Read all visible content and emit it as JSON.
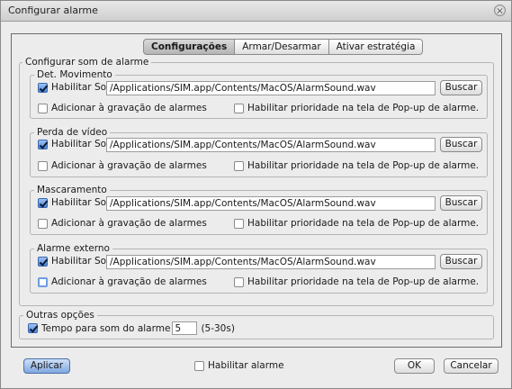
{
  "window": {
    "title": "Configurar alarme",
    "close_glyph": "×"
  },
  "tabs": [
    {
      "label": "Configurações",
      "active": true
    },
    {
      "label": "Armar/Desarmar",
      "active": false
    },
    {
      "label": "Ativar estratégia",
      "active": false
    }
  ],
  "sound_section": {
    "legend": "Configurar som de alarme",
    "groups": [
      {
        "legend": "Det. Movimento",
        "enable_label": "Habilitar Som",
        "enable_checked": true,
        "path": "/Applications/SIM.app/Contents/MacOS/AlarmSound.wav",
        "browse_label": "Buscar",
        "record_label": "Adicionar à gravação de alarmes",
        "record_checked": false,
        "priority_label": "Habilitar prioridade na tela de Pop-up de alarme.",
        "priority_checked": false
      },
      {
        "legend": "Perda de vídeo",
        "enable_label": "Habilitar Som",
        "enable_checked": true,
        "path": "/Applications/SIM.app/Contents/MacOS/AlarmSound.wav",
        "browse_label": "Buscar",
        "record_label": "Adicionar à gravação de alarmes",
        "record_checked": false,
        "priority_label": "Habilitar prioridade na tela de Pop-up de alarme.",
        "priority_checked": false
      },
      {
        "legend": "Mascaramento",
        "enable_label": "Habilitar Som",
        "enable_checked": true,
        "path": "/Applications/SIM.app/Contents/MacOS/AlarmSound.wav",
        "browse_label": "Buscar",
        "record_label": "Adicionar à gravação de alarmes",
        "record_checked": false,
        "priority_label": "Habilitar prioridade na tela de Pop-up de alarme.",
        "priority_checked": false
      },
      {
        "legend": "Alarme externo",
        "enable_label": "Habilitar Som",
        "enable_checked": true,
        "path": "/Applications/SIM.app/Contents/MacOS/AlarmSound.wav",
        "browse_label": "Buscar",
        "record_label": "Adicionar à gravação de alarmes",
        "record_checked": false,
        "priority_label": "Habilitar prioridade na tela de Pop-up de alarme.",
        "priority_checked": false
      }
    ]
  },
  "other_options": {
    "legend": "Outras opções",
    "duration_label": "Tempo para som do alarme",
    "duration_checked": true,
    "duration_value": "5",
    "duration_range": "(5-30s)"
  },
  "footer": {
    "apply_label": "Aplicar",
    "enable_alarm_label": "Habilitar alarme",
    "enable_alarm_checked": false,
    "ok_label": "OK",
    "cancel_label": "Cancelar"
  }
}
